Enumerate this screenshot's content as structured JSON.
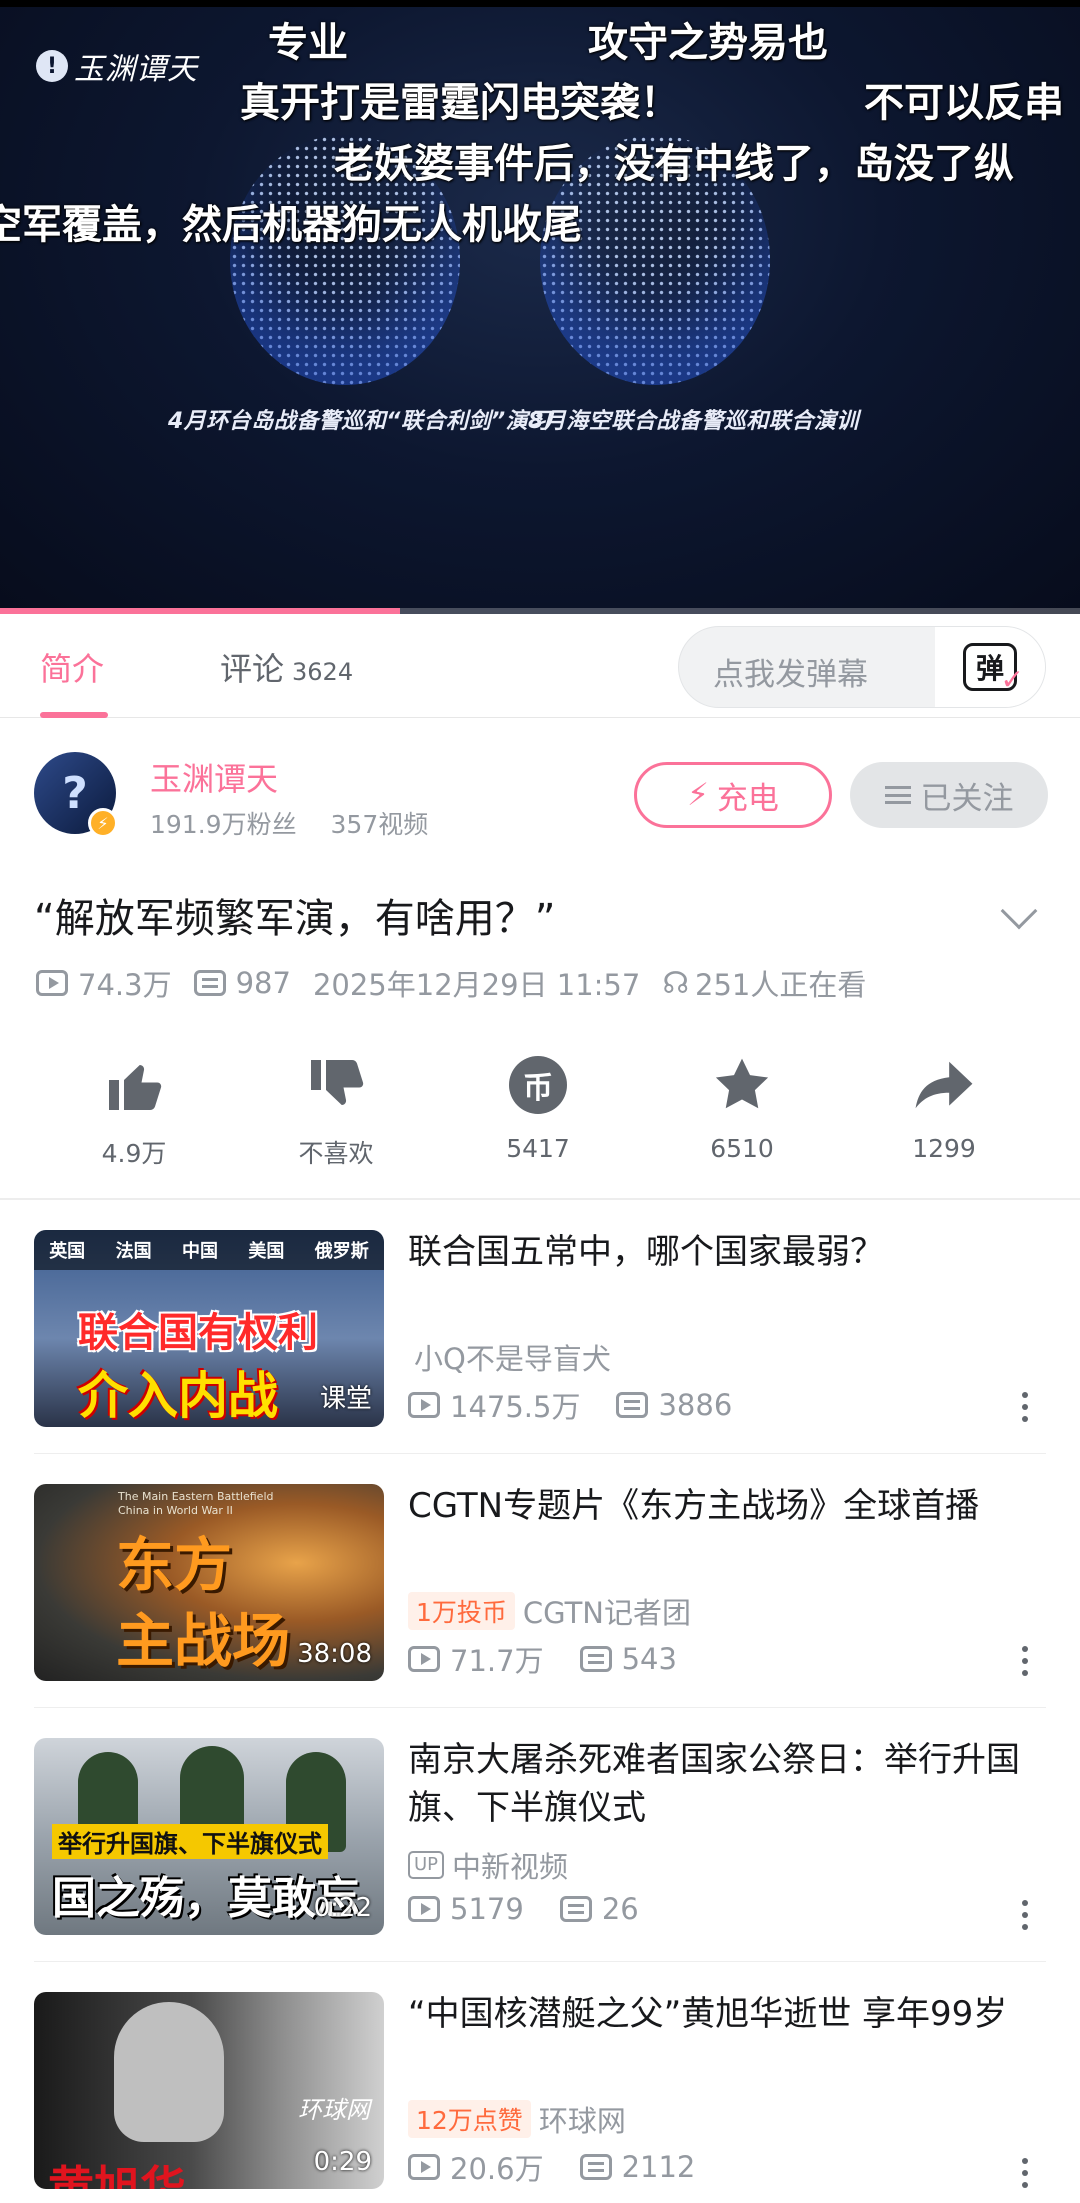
{
  "player": {
    "channel_logo_text": "玉渊谭天",
    "danmaku": [
      "专业",
      "攻守之势易也",
      "真开打是雷霆闪电突袭！",
      "不可以反串",
      "老妖婆事件后，没有中线了，岛没了纵",
      "空军覆盖，然后机器狗无人机收尾"
    ],
    "caption_left": "4月环台岛战备警巡和“联合利剑”演习",
    "caption_right": "8月海空联合战备警巡和联合演训",
    "progress": 0.37
  },
  "tabs": {
    "intro": "简介",
    "comments": "评论",
    "comments_count": "3624",
    "danmaku_placeholder": "点我发弹幕",
    "danmaku_button_glyph": "弹"
  },
  "uploader": {
    "avatar_glyph": "?",
    "name": "玉渊谭天",
    "followers": "191.9万粉丝",
    "videos": "357视频",
    "charge_label": "充电",
    "follow_label": "已关注"
  },
  "video": {
    "title": "“解放军频繁军演，有啥用？”",
    "views": "74.3万",
    "danmaku_count": "987",
    "date": "2025年12月29日 11:57",
    "watching": "251人正在看"
  },
  "actions": {
    "like": "4.9万",
    "dislike": "不喜欢",
    "coin": "5417",
    "favorite": "6510",
    "share": "1299"
  },
  "recommendations": [
    {
      "title": "联合国五常中，哪个国家最弱？",
      "author": "小Q不是导盲犬",
      "tag": "",
      "views": "1475.5万",
      "danmaku": "3886",
      "duration": "",
      "thumb_flags": [
        "英国",
        "法国",
        "中国",
        "美国",
        "俄罗斯"
      ],
      "thumb_text": "联合国有权利",
      "thumb_text2": "介入内战",
      "thumb_corner": "课堂"
    },
    {
      "title": "CGTN专题片《东方主战场》全球首播",
      "author": "CGTN记者团",
      "tag": "1万投币",
      "views": "71.7万",
      "danmaku": "543",
      "duration": "38:08",
      "thumb_small": "The Main Eastern Battlefield China in World War II",
      "thumb_text": "东方",
      "thumb_text2": "主战场"
    },
    {
      "title": "南京大屠杀死难者国家公祭日：举行升国旗、下半旗仪式",
      "author": "中新视频",
      "tag": "",
      "up_badge": "UP",
      "views": "5179",
      "danmaku": "26",
      "duration": "0:22",
      "thumb_text": "举行升国旗、下半旗仪式",
      "thumb_text2": "国之殇，莫敢忘"
    },
    {
      "title": "“中国核潜艇之父”黄旭华逝世 享年99岁",
      "author": "环球网",
      "tag": "12万点赞",
      "views": "20.6万",
      "danmaku": "2112",
      "duration": "0:29",
      "thumb_corner": "环球网",
      "thumb_text": "黄旭华"
    }
  ],
  "colors": {
    "accent": "#fb7299",
    "text_secondary": "#9499a0",
    "tag_orange": "#ff6a3d"
  }
}
